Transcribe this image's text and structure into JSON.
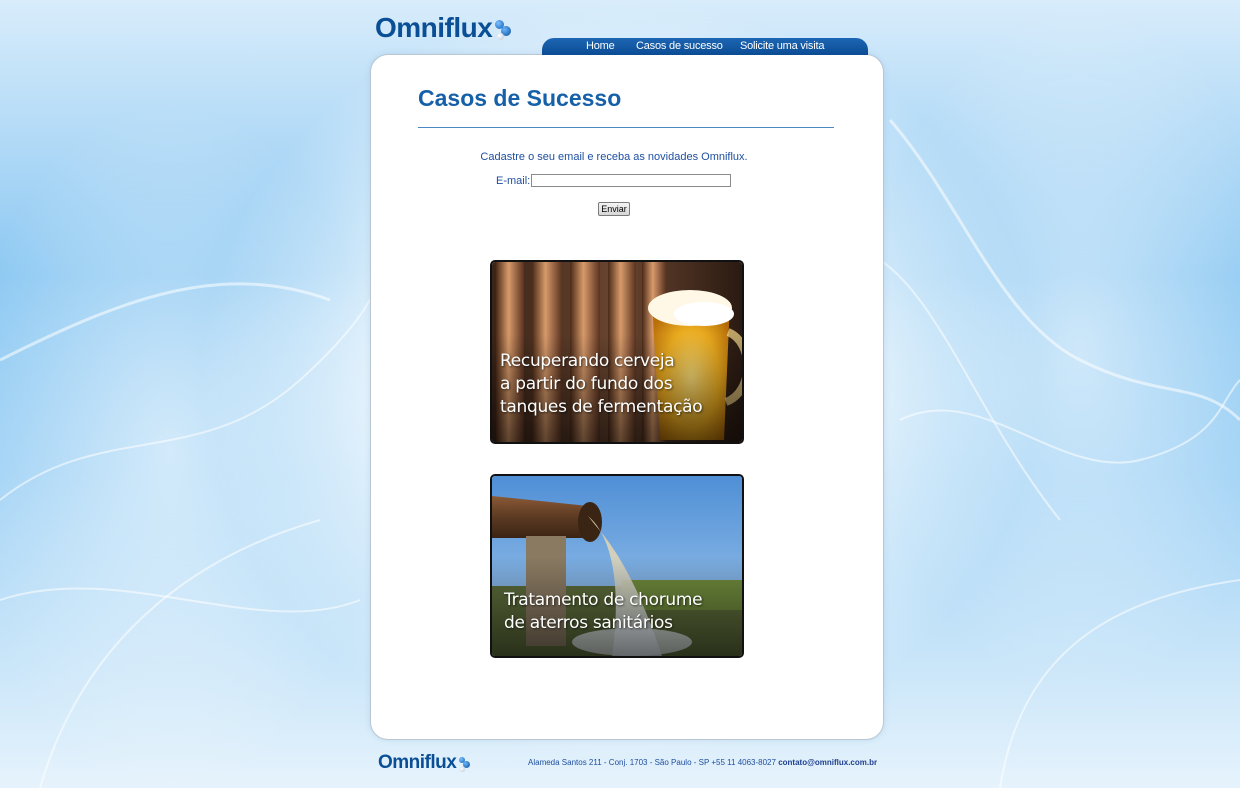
{
  "brand": {
    "logo_text": "Omniflux"
  },
  "nav": {
    "items": [
      {
        "label": "Home"
      },
      {
        "label": "Casos de sucesso"
      },
      {
        "label": "Solicite uma visita"
      }
    ]
  },
  "main": {
    "title": "Casos de Sucesso",
    "newsletter": {
      "text": "Cadastre o seu email e receba as novidades Omniflux.",
      "email_label": "E-mail:",
      "email_value": "",
      "submit_label": "Enviar"
    },
    "cases": [
      {
        "caption": "Recuperando cerveja\na partir do fundo dos\ntanques de fermentação",
        "image": "beer-tanks-image"
      },
      {
        "caption": "Tratamento de chorume\nde aterros sanitários",
        "image": "landfill-pipe-image"
      }
    ]
  },
  "footer": {
    "logo_text": "Omniflux",
    "address": "Alameda Santos 211 - Conj. 1703 - São Paulo - SP +55 11 4063-8027",
    "email": "contato@omniflux.com.br"
  },
  "colors": {
    "brand_blue": "#0a4f96",
    "nav_blue": "#0b4c93",
    "title_blue": "#1560a8"
  }
}
